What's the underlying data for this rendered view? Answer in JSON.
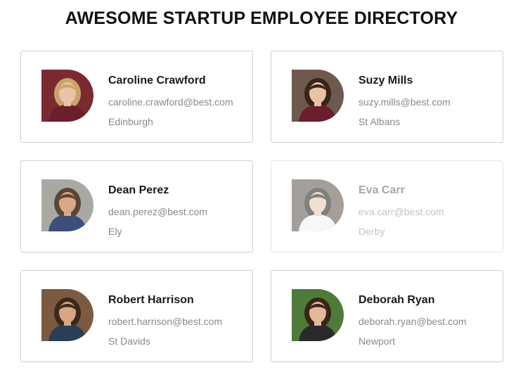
{
  "page": {
    "title": "AWESOME STARTUP EMPLOYEE DIRECTORY"
  },
  "employees": [
    {
      "name": "Caroline Crawford",
      "email": "caroline.crawford@best.com",
      "city": "Edinburgh",
      "faded": false,
      "photo": {
        "bg": "#7a2a30",
        "hair": "#c9a46a",
        "skin": "#e9c4a8",
        "shirt": "#6b1f2a"
      }
    },
    {
      "name": "Suzy Mills",
      "email": "suzy.mills@best.com",
      "city": "St Albans",
      "faded": false,
      "photo": {
        "bg": "#6e5a4c",
        "hair": "#3a2418",
        "skin": "#e8c2a6",
        "shirt": "#6a1e2e"
      }
    },
    {
      "name": "Dean Perez",
      "email": "dean.perez@best.com",
      "city": "Ely",
      "faded": false,
      "photo": {
        "bg": "#a8a9a3",
        "hair": "#5a4634",
        "skin": "#d9a888",
        "shirt": "#3b4f7a"
      }
    },
    {
      "name": "Eva Carr",
      "email": "eva.carr@best.com",
      "city": "Derby",
      "faded": true,
      "photo": {
        "bg": "#5a5248",
        "hair": "#1c1a18",
        "skin": "#e6c7ae",
        "shirt": "#f2f2f2"
      }
    },
    {
      "name": "Robert Harrison",
      "email": "robert.harrison@best.com",
      "city": "St Davids",
      "faded": false,
      "photo": {
        "bg": "#7b5a3f",
        "hair": "#3b2a1c",
        "skin": "#d7a684",
        "shirt": "#2c3e55"
      }
    },
    {
      "name": "Deborah Ryan",
      "email": "deborah.ryan@best.com",
      "city": "Newport",
      "faded": false,
      "photo": {
        "bg": "#4f7b3a",
        "hair": "#3a2416",
        "skin": "#e2b898",
        "shirt": "#2a2a2a"
      }
    }
  ]
}
